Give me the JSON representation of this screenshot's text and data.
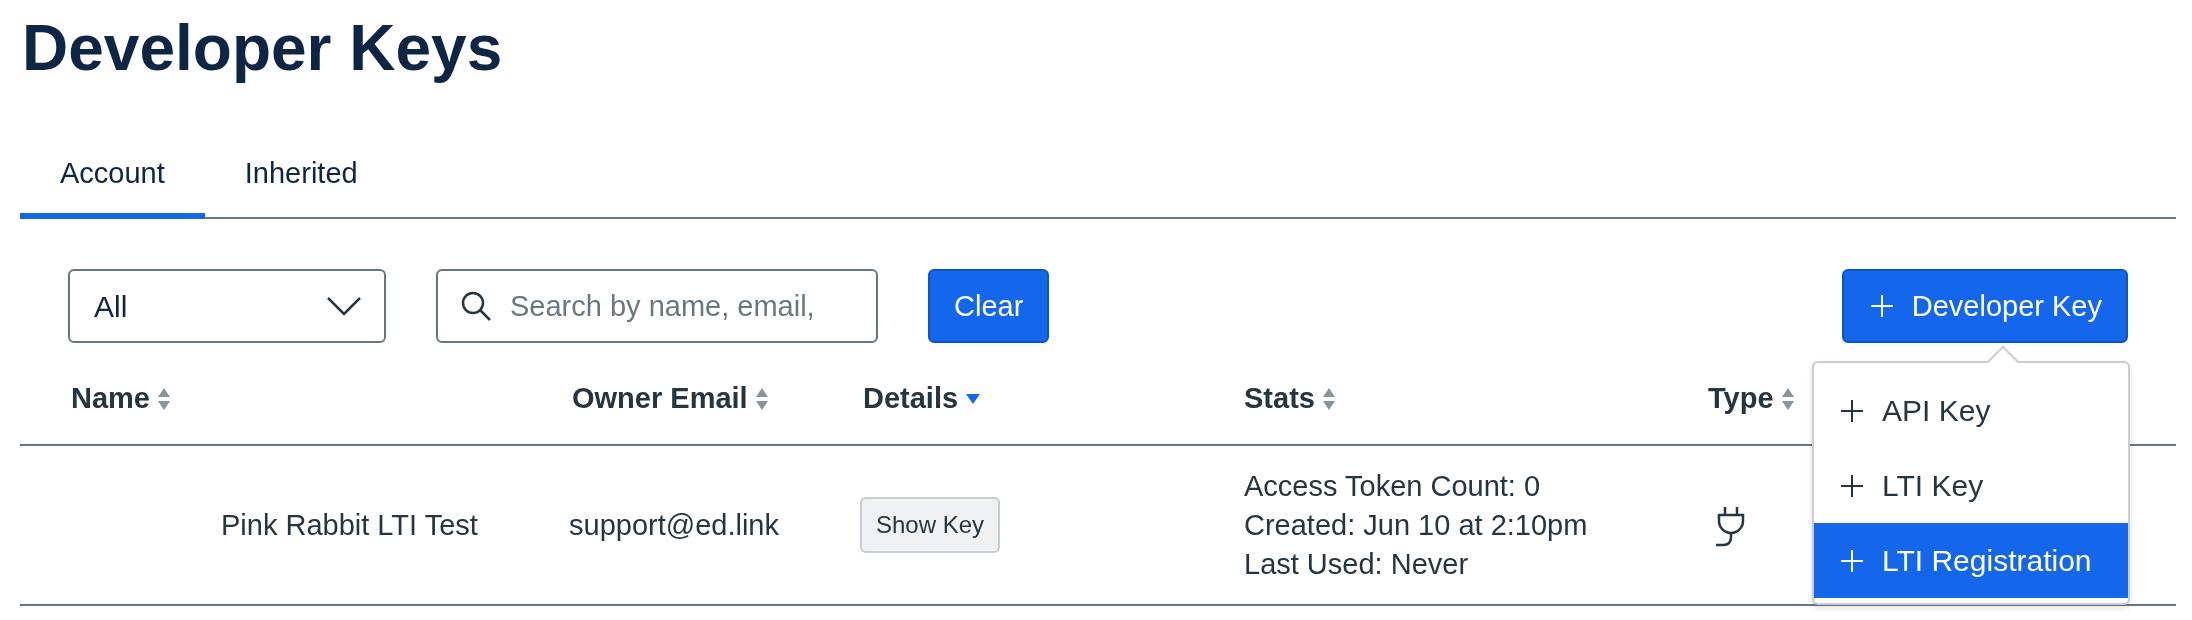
{
  "page": {
    "title": "Developer Keys"
  },
  "tabs": [
    {
      "label": "Account",
      "selected": true
    },
    {
      "label": "Inherited",
      "selected": false
    }
  ],
  "filter": {
    "value": "All"
  },
  "search": {
    "placeholder": "Search by name, email,"
  },
  "clear_button": "Clear",
  "add_button": "Developer Key",
  "menu": {
    "items": [
      {
        "label": "API Key",
        "selected": false
      },
      {
        "label": "LTI Key",
        "selected": false
      },
      {
        "label": "LTI Registration",
        "selected": true
      }
    ]
  },
  "table": {
    "columns": [
      {
        "label": "Name",
        "sorted": false
      },
      {
        "label": "Owner Email",
        "sorted": false
      },
      {
        "label": "Details",
        "sorted": true
      },
      {
        "label": "Stats",
        "sorted": false
      },
      {
        "label": "Type",
        "sorted": false
      }
    ],
    "rows": [
      {
        "name": "Pink Rabbit LTI Test",
        "owner_email": "support@ed.link",
        "details_button": "Show Key",
        "stats": [
          "Access Token Count: 0",
          "Created: Jun 10 at 2:10pm",
          "Last Used: Never"
        ],
        "kind": "lti"
      }
    ]
  }
}
